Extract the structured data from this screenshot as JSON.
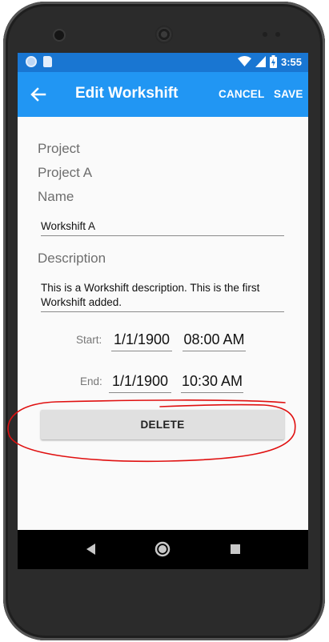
{
  "status_bar": {
    "time": "3:55"
  },
  "app_bar": {
    "back_icon": "arrow-left-icon",
    "title": "Edit Workshift",
    "cancel_label": "CANCEL",
    "save_label": "SAVE",
    "color": "#2196f3",
    "status_color": "#1976d2"
  },
  "form": {
    "project_label": "Project",
    "project_value": "Project A",
    "name_label": "Name",
    "name_value": "Workshift A",
    "description_label": "Description",
    "description_value": "This is a Workshift description. This is the first Workshift added.",
    "start": {
      "label": "Start:",
      "date": "1/1/1900",
      "time": "08:00 AM"
    },
    "end": {
      "label": "End:",
      "date": "1/1/1900",
      "time": "10:30 AM"
    },
    "delete_label": "DELETE"
  },
  "annotation": {
    "color": "#e01010"
  },
  "nav_bar": {
    "icons": [
      "back-triangle-icon",
      "home-circle-icon",
      "recents-square-icon"
    ]
  }
}
